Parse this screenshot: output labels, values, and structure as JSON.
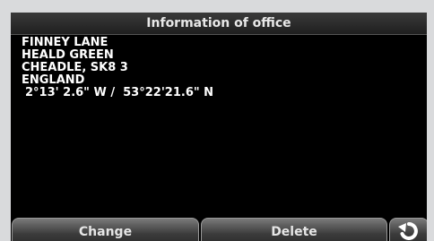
{
  "header": {
    "title": "Information of office"
  },
  "info": {
    "lines": [
      "FINNEY LANE",
      "HEALD GREEN",
      "CHEADLE, SK8 3",
      "ENGLAND"
    ],
    "coordinates": "2°13' 2.6\" W /  53°22'21.6\" N"
  },
  "buttons": {
    "change_label": "Change",
    "delete_label": "Delete",
    "back_icon": "back-arrow-icon"
  }
}
